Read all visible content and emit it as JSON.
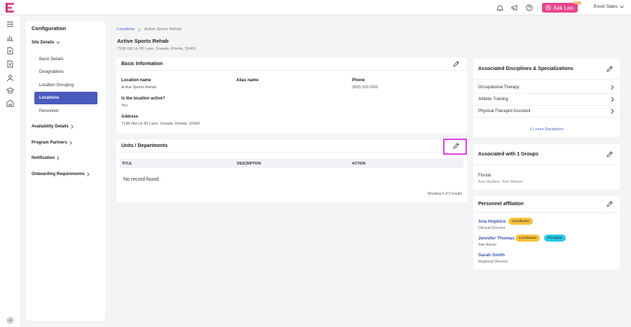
{
  "header": {
    "ask_label": "Ask Leo",
    "beta": "BETA",
    "org_name": "Excel Sales"
  },
  "config": {
    "title": "Configuration",
    "site_details": "Site Details",
    "items": [
      "Basic Details",
      "Designations",
      "Location Grouping",
      "Locations",
      "Personnel"
    ],
    "sections": [
      "Availability Details",
      "Program Partners",
      "Notification",
      "Onboarding Requirements"
    ]
  },
  "breadcrumb": {
    "parent": "Locations",
    "current": "Active Sports Rehab"
  },
  "location": {
    "name": "Active Sports Rehab",
    "address_line": "7198 Old Us 90 Lane, Sneads, Florida, 32460"
  },
  "basic_info": {
    "title": "Basic Information",
    "location_name_label": "Location name",
    "location_name": "Active Sports Rehab",
    "alias_label": "Alias name",
    "phone_label": "Phone",
    "phone": "(800) 200-2002",
    "active_label": "Is the location active?",
    "active_value": "Yes",
    "address_label": "Address",
    "address": "7198 Old Us 90 Lane, Sneads, Florida, 32460"
  },
  "units": {
    "title": "Units / Departments",
    "columns": [
      "TITLE",
      "DESCRIPTION",
      "ACTION"
    ],
    "empty": "No record found",
    "showing": "Showing 0 of 0 results"
  },
  "disciplines": {
    "title": "Associated Disciplines & Specializations",
    "items": [
      "Occupational Therapy",
      "Athletic Training",
      "Physical Therapist Assistant"
    ],
    "more": "+1 more Disciplines"
  },
  "groups": {
    "title": "Associated with 1 Groups",
    "group_name": "Florida",
    "members": "Ana Hopkins, Bob Watson"
  },
  "personnel": {
    "title": "Personnel affliation",
    "people": [
      {
        "name": "Ana Hopkins",
        "role": "Clinical Director",
        "badges": [
          "Coordinator"
        ]
      },
      {
        "name": "Jennifer Thomas",
        "role": "Site Admin",
        "badges": [
          "Coordinator",
          "Preceptor"
        ]
      },
      {
        "name": "Sarah Smith",
        "role": "Regional Director",
        "badges": []
      }
    ]
  },
  "colors": {
    "accent": "#4a5bbd",
    "brand": "#e8448c",
    "coordinator": "#f6c13b",
    "preceptor": "#27c8e8",
    "highlight": "#e040e0"
  },
  "icons": [
    "bell-icon",
    "megaphone-icon",
    "help-icon",
    "menu-icon",
    "chart-icon",
    "file-icon",
    "document-icon",
    "users-icon",
    "graduation-icon",
    "building-icon",
    "settings-icon",
    "pencil-icon",
    "chevron-right-icon"
  ]
}
